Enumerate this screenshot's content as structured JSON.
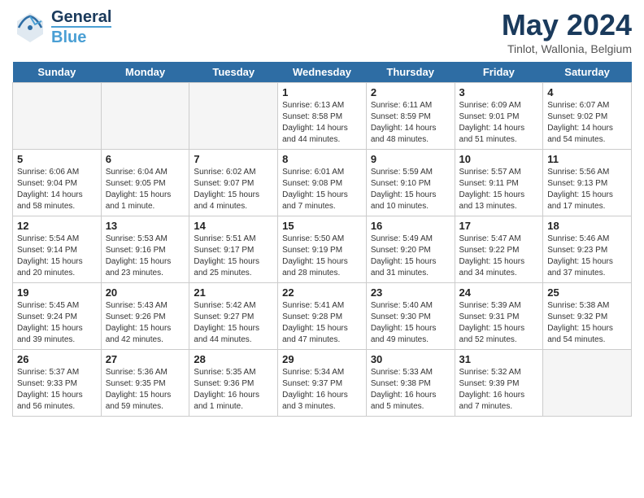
{
  "logo": {
    "line1": "General",
    "line2": "Blue"
  },
  "title": "May 2024",
  "location": "Tinlot, Wallonia, Belgium",
  "headers": [
    "Sunday",
    "Monday",
    "Tuesday",
    "Wednesday",
    "Thursday",
    "Friday",
    "Saturday"
  ],
  "weeks": [
    [
      {
        "num": "",
        "info": ""
      },
      {
        "num": "",
        "info": ""
      },
      {
        "num": "",
        "info": ""
      },
      {
        "num": "1",
        "info": "Sunrise: 6:13 AM\nSunset: 8:58 PM\nDaylight: 14 hours\nand 44 minutes."
      },
      {
        "num": "2",
        "info": "Sunrise: 6:11 AM\nSunset: 8:59 PM\nDaylight: 14 hours\nand 48 minutes."
      },
      {
        "num": "3",
        "info": "Sunrise: 6:09 AM\nSunset: 9:01 PM\nDaylight: 14 hours\nand 51 minutes."
      },
      {
        "num": "4",
        "info": "Sunrise: 6:07 AM\nSunset: 9:02 PM\nDaylight: 14 hours\nand 54 minutes."
      }
    ],
    [
      {
        "num": "5",
        "info": "Sunrise: 6:06 AM\nSunset: 9:04 PM\nDaylight: 14 hours\nand 58 minutes."
      },
      {
        "num": "6",
        "info": "Sunrise: 6:04 AM\nSunset: 9:05 PM\nDaylight: 15 hours\nand 1 minute."
      },
      {
        "num": "7",
        "info": "Sunrise: 6:02 AM\nSunset: 9:07 PM\nDaylight: 15 hours\nand 4 minutes."
      },
      {
        "num": "8",
        "info": "Sunrise: 6:01 AM\nSunset: 9:08 PM\nDaylight: 15 hours\nand 7 minutes."
      },
      {
        "num": "9",
        "info": "Sunrise: 5:59 AM\nSunset: 9:10 PM\nDaylight: 15 hours\nand 10 minutes."
      },
      {
        "num": "10",
        "info": "Sunrise: 5:57 AM\nSunset: 9:11 PM\nDaylight: 15 hours\nand 13 minutes."
      },
      {
        "num": "11",
        "info": "Sunrise: 5:56 AM\nSunset: 9:13 PM\nDaylight: 15 hours\nand 17 minutes."
      }
    ],
    [
      {
        "num": "12",
        "info": "Sunrise: 5:54 AM\nSunset: 9:14 PM\nDaylight: 15 hours\nand 20 minutes."
      },
      {
        "num": "13",
        "info": "Sunrise: 5:53 AM\nSunset: 9:16 PM\nDaylight: 15 hours\nand 23 minutes."
      },
      {
        "num": "14",
        "info": "Sunrise: 5:51 AM\nSunset: 9:17 PM\nDaylight: 15 hours\nand 25 minutes."
      },
      {
        "num": "15",
        "info": "Sunrise: 5:50 AM\nSunset: 9:19 PM\nDaylight: 15 hours\nand 28 minutes."
      },
      {
        "num": "16",
        "info": "Sunrise: 5:49 AM\nSunset: 9:20 PM\nDaylight: 15 hours\nand 31 minutes."
      },
      {
        "num": "17",
        "info": "Sunrise: 5:47 AM\nSunset: 9:22 PM\nDaylight: 15 hours\nand 34 minutes."
      },
      {
        "num": "18",
        "info": "Sunrise: 5:46 AM\nSunset: 9:23 PM\nDaylight: 15 hours\nand 37 minutes."
      }
    ],
    [
      {
        "num": "19",
        "info": "Sunrise: 5:45 AM\nSunset: 9:24 PM\nDaylight: 15 hours\nand 39 minutes."
      },
      {
        "num": "20",
        "info": "Sunrise: 5:43 AM\nSunset: 9:26 PM\nDaylight: 15 hours\nand 42 minutes."
      },
      {
        "num": "21",
        "info": "Sunrise: 5:42 AM\nSunset: 9:27 PM\nDaylight: 15 hours\nand 44 minutes."
      },
      {
        "num": "22",
        "info": "Sunrise: 5:41 AM\nSunset: 9:28 PM\nDaylight: 15 hours\nand 47 minutes."
      },
      {
        "num": "23",
        "info": "Sunrise: 5:40 AM\nSunset: 9:30 PM\nDaylight: 15 hours\nand 49 minutes."
      },
      {
        "num": "24",
        "info": "Sunrise: 5:39 AM\nSunset: 9:31 PM\nDaylight: 15 hours\nand 52 minutes."
      },
      {
        "num": "25",
        "info": "Sunrise: 5:38 AM\nSunset: 9:32 PM\nDaylight: 15 hours\nand 54 minutes."
      }
    ],
    [
      {
        "num": "26",
        "info": "Sunrise: 5:37 AM\nSunset: 9:33 PM\nDaylight: 15 hours\nand 56 minutes."
      },
      {
        "num": "27",
        "info": "Sunrise: 5:36 AM\nSunset: 9:35 PM\nDaylight: 15 hours\nand 59 minutes."
      },
      {
        "num": "28",
        "info": "Sunrise: 5:35 AM\nSunset: 9:36 PM\nDaylight: 16 hours\nand 1 minute."
      },
      {
        "num": "29",
        "info": "Sunrise: 5:34 AM\nSunset: 9:37 PM\nDaylight: 16 hours\nand 3 minutes."
      },
      {
        "num": "30",
        "info": "Sunrise: 5:33 AM\nSunset: 9:38 PM\nDaylight: 16 hours\nand 5 minutes."
      },
      {
        "num": "31",
        "info": "Sunrise: 5:32 AM\nSunset: 9:39 PM\nDaylight: 16 hours\nand 7 minutes."
      },
      {
        "num": "",
        "info": ""
      }
    ]
  ]
}
